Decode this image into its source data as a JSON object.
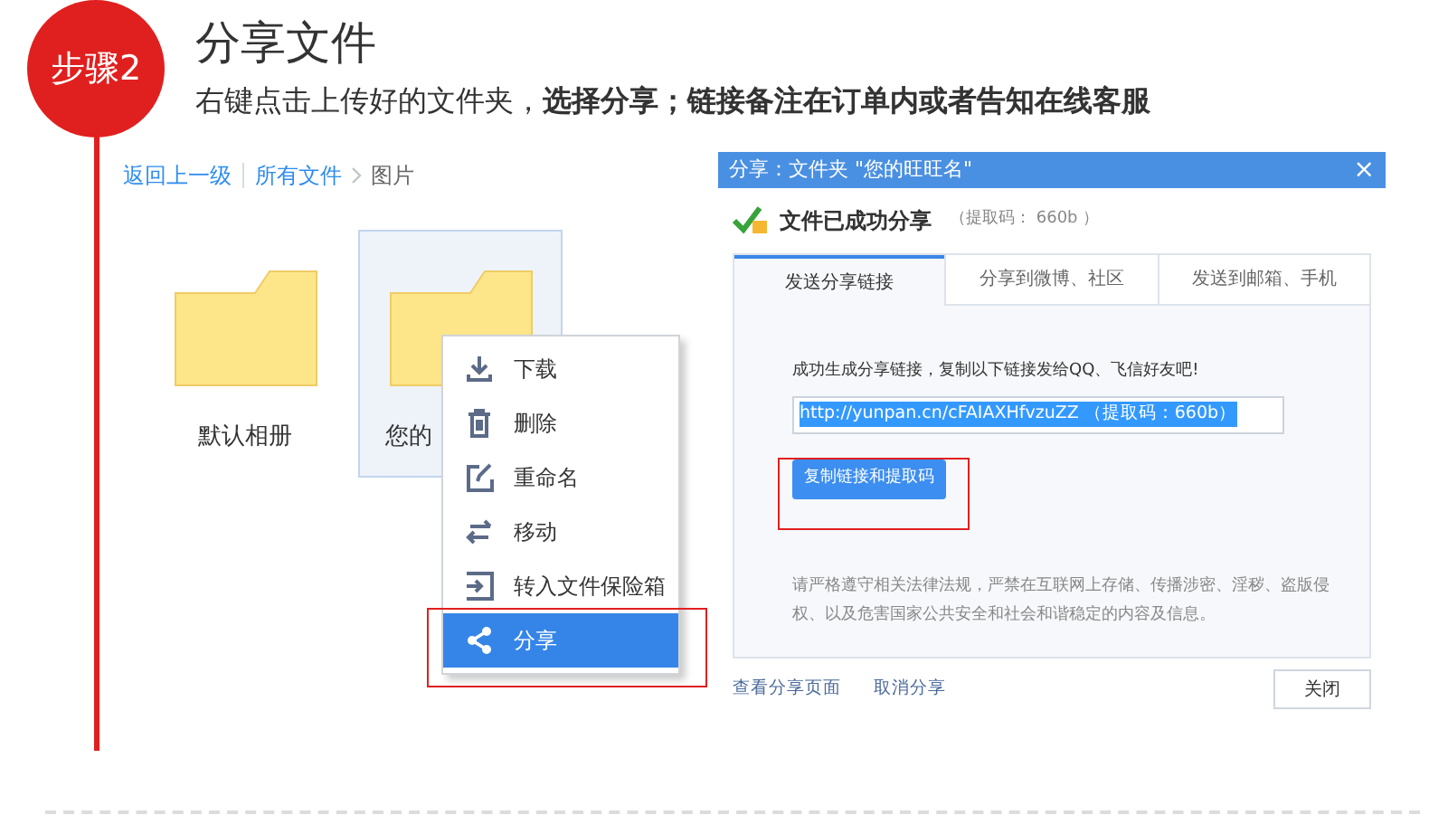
{
  "step": {
    "badge": "步骤2",
    "title": "分享文件",
    "subtitle": "右键点击上传好的文件夹，**选择分享；链接备注在订单内或者告知在线客服**"
  },
  "file_browser": {
    "breadcrumb": [
      {
        "label": "返回上一级",
        "kind": "link"
      },
      {
        "label": "所有文件",
        "kind": "link"
      },
      {
        "label": "图片",
        "kind": "current"
      }
    ],
    "folders": [
      {
        "name": "默认相册",
        "selected": false
      },
      {
        "name": "您的",
        "selected": true
      }
    ],
    "context_menu": [
      {
        "label": "下载",
        "selected": false
      },
      {
        "label": "删除",
        "selected": false
      },
      {
        "label": "重命名",
        "selected": false
      },
      {
        "label": "移动",
        "selected": false
      },
      {
        "label": "转入文件保险箱",
        "selected": false
      },
      {
        "label": "分享",
        "selected": true
      }
    ]
  },
  "share_dialog": {
    "title": "分享：文件夹 \"您的旺旺名\"",
    "close": "×",
    "status": "文件已成功分享",
    "code_hint": "（提取码： 660b ）",
    "tabs": [
      {
        "label": "发送分享链接",
        "selected": true
      },
      {
        "label": "分享到微博、社区",
        "selected": false
      },
      {
        "label": "发送到邮箱、手机",
        "selected": false
      }
    ],
    "message": "成功生成分享链接，复制以下链接发给QQ、飞信好友吧!",
    "link": "http://yunpan.cn/cFAIAXHfvzuZZ （提取码：660b）",
    "copy_button": "复制链接和提取码",
    "notice": "请严格遵守相关法律法规，严禁在互联网上存储、传播涉密、淫秽、盗版侵权、以及危害国家公共安全和社会和谐稳定的内容及信息。",
    "footer_links": [
      "查看分享页面",
      "取消分享"
    ],
    "close_button": "关闭"
  }
}
